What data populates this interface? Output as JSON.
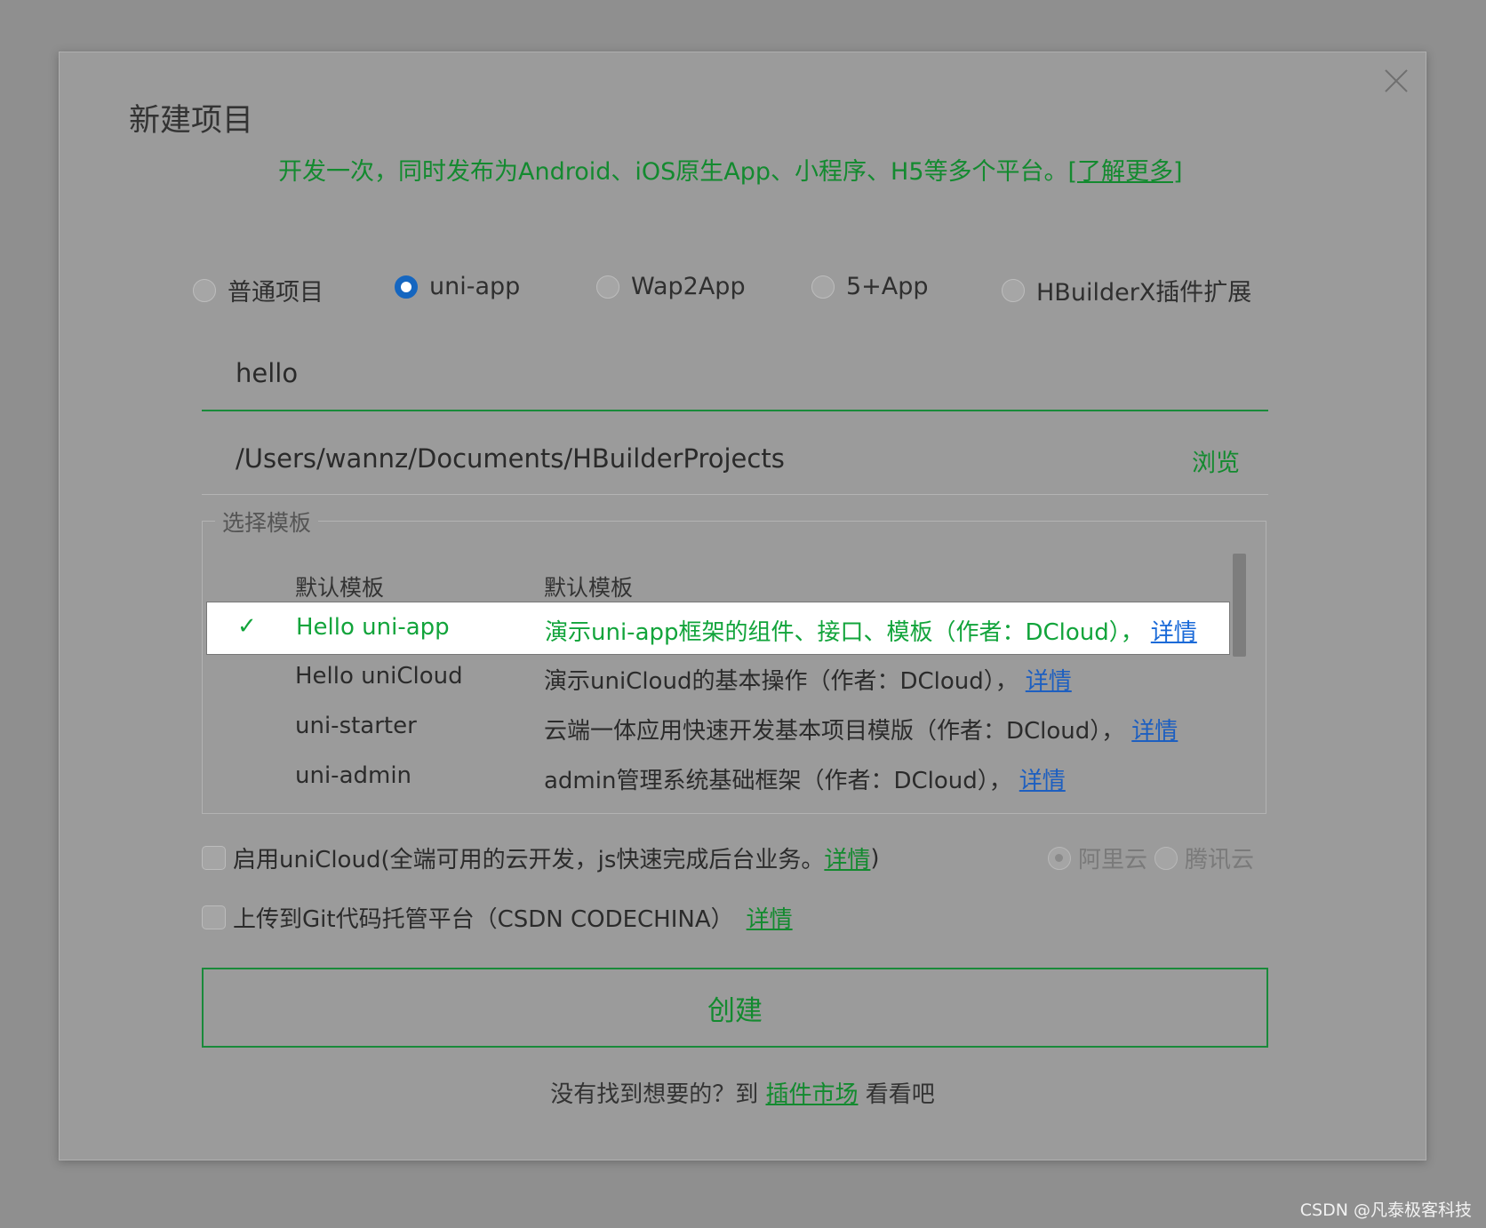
{
  "dialog": {
    "title": "新建项目",
    "subtitle": "开发一次，同时发布为Android、iOS原生App、小程序、H5等多个平台。",
    "learn_more": "[了解更多]"
  },
  "project_types": [
    {
      "label": "普通项目",
      "checked": false
    },
    {
      "label": "uni-app",
      "checked": true
    },
    {
      "label": "Wap2App",
      "checked": false
    },
    {
      "label": "5+App",
      "checked": false
    },
    {
      "label": "HBuilderX插件扩展",
      "checked": false
    }
  ],
  "project_name": "hello",
  "project_path": "/Users/wannz/Documents/HBuilderProjects",
  "browse_label": "浏览",
  "templates": {
    "legend": "选择模板",
    "header_name": "默认模板",
    "header_desc": "默认模板",
    "check_mark": "✓",
    "rows": [
      {
        "name": "Hello uni-app",
        "desc": "演示uni-app框架的组件、接口、模板（作者：DCloud），",
        "link": "详情",
        "selected": true
      },
      {
        "name": "Hello uniCloud",
        "desc": "演示uniCloud的基本操作（作者：DCloud），",
        "link": "详情",
        "selected": false
      },
      {
        "name": "uni-starter",
        "desc": "云端一体应用快速开发基本项目模版（作者：DCloud），",
        "link": "详情",
        "selected": false
      },
      {
        "name": "uni-admin",
        "desc": "admin管理系统基础框架（作者：DCloud），",
        "link": "详情",
        "selected": false
      }
    ]
  },
  "unicloud": {
    "text": "启用uniCloud(全端可用的云开发，js快速完成后台业务。",
    "link": "详情",
    "close": ")",
    "checked": false,
    "providers": [
      "阿里云",
      "腾讯云"
    ]
  },
  "git": {
    "text": "上传到Git代码托管平台（CSDN CODECHINA）",
    "link": "详情",
    "checked": false
  },
  "create_label": "创建",
  "footer": {
    "prefix": "没有找到想要的？到",
    "link": "插件市场",
    "suffix": "看看吧"
  },
  "watermark": "CSDN @凡泰极客科技"
}
